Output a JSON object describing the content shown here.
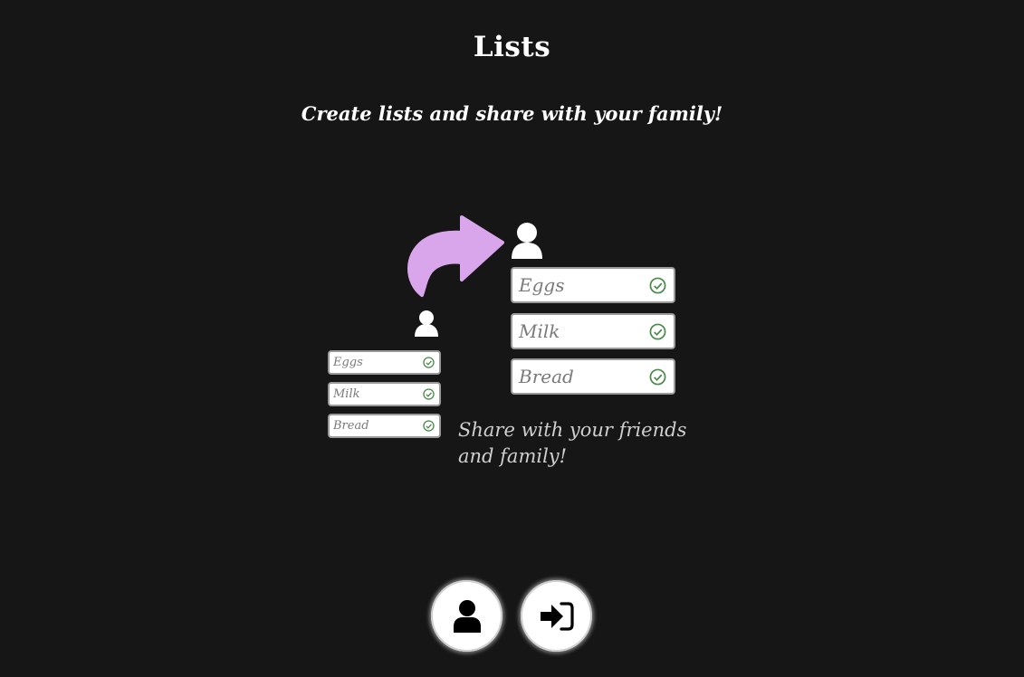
{
  "header": {
    "title": "Lists",
    "subtitle": "Create lists and share with your family!"
  },
  "illustration": {
    "small_list": [
      "Eggs",
      "Milk",
      "Bread"
    ],
    "big_list": [
      "Eggs",
      "Milk",
      "Bread"
    ],
    "share_text_line1": "Share with your friends",
    "share_text_line2": "and family!",
    "arrow_color": "#d9a6ec",
    "check_color": "#4a8a4a"
  },
  "actions": {
    "profile_icon": "user-icon",
    "login_icon": "sign-in-icon"
  }
}
